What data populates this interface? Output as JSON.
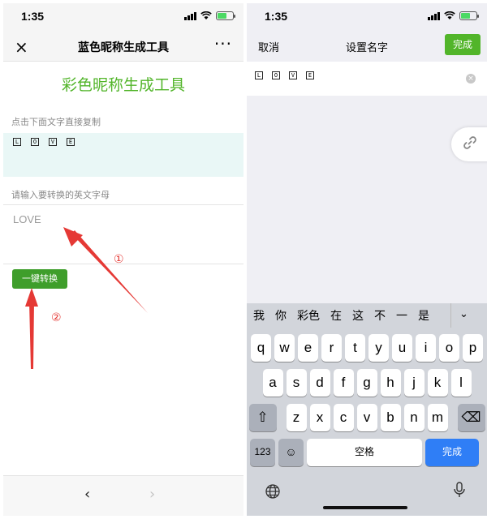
{
  "left": {
    "status": {
      "time": "1:35"
    },
    "nav": {
      "close_icon": "×",
      "title": "蓝色昵称生成工具",
      "more_icon": "···"
    },
    "page_title": "彩色昵称生成工具",
    "copy_label": "点击下面文字直接复制",
    "result_letters": [
      "L",
      "O",
      "V",
      "E"
    ],
    "input_label": "请输入要转换的英文字母",
    "input_value": "LOVE",
    "convert_button": "一键转换",
    "bottom_nav": {
      "back": "‹",
      "forward": "›"
    }
  },
  "annotations": {
    "step1": "①",
    "step2": "②",
    "arrow_color": "#e53935"
  },
  "right": {
    "status": {
      "time": "1:35"
    },
    "nav": {
      "cancel": "取消",
      "title": "设置名字",
      "done": "完成"
    },
    "name_letters": [
      "L",
      "O",
      "V",
      "E"
    ],
    "candidates": [
      "我",
      "你",
      "彩色",
      "在",
      "这",
      "不",
      "一",
      "是"
    ],
    "keyboard": {
      "row1": [
        "q",
        "w",
        "e",
        "r",
        "t",
        "y",
        "u",
        "i",
        "o",
        "p"
      ],
      "row2": [
        "a",
        "s",
        "d",
        "f",
        "g",
        "h",
        "j",
        "k",
        "l"
      ],
      "row3": [
        "z",
        "x",
        "c",
        "v",
        "b",
        "n",
        "m"
      ],
      "num_key": "123",
      "space_key": "空格",
      "done_key": "完成"
    }
  },
  "colors": {
    "accent_green": "#52b52a",
    "button_green": "#3f9e2b",
    "ios_blue": "#2f7ef6"
  }
}
